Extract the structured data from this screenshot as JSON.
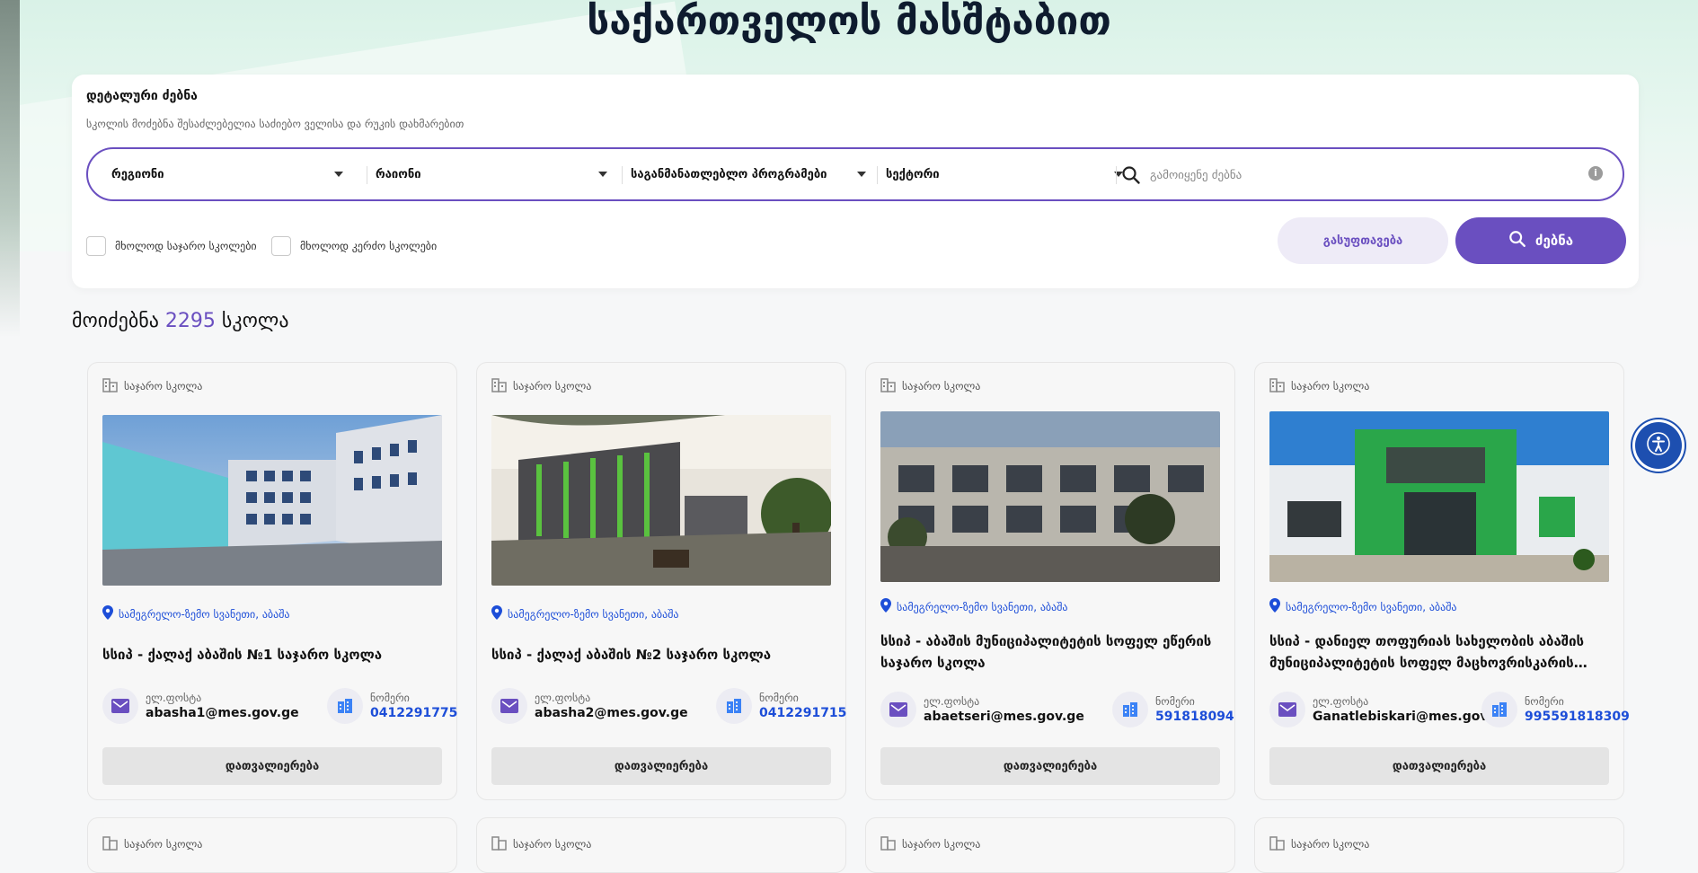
{
  "header": {
    "title": "საქართველოს მასშტაბით"
  },
  "search": {
    "title": "დეტალური ძებნა",
    "subtitle": "სკოლის მოძებნა შესაძლებელია საძიებო ველისა და რუკის დახმარებით",
    "filters": [
      {
        "label": "რეგიონი"
      },
      {
        "label": "რაიონი"
      },
      {
        "label": "საგანმანათლებლო პროგრამები"
      },
      {
        "label": "სექტორი"
      }
    ],
    "placeholder": "გამოიყენე ძებნა",
    "checkbox_public": "მხოლოდ საჯარო სკოლები",
    "checkbox_private": "მხოლოდ კერძო სკოლები",
    "clear_label": "გასუფთავება",
    "search_label": "ძებნა"
  },
  "results": {
    "prefix": "მოიძებნა",
    "count": "2295",
    "suffix": "სკოლა"
  },
  "schools": [
    {
      "type": "საჯარო სკოლა",
      "location": "სამეგრელო-ზემო სვანეთი, აბაშა",
      "name": "სსიპ - ქალაქ აბაშის №1 საჯარო სკოლა",
      "email_label": "ელ.ფოსტა",
      "email": "abasha1@mes.gov.ge",
      "phone_label": "ნომერი",
      "phone": "0412291775",
      "button": "დათვალიერება"
    },
    {
      "type": "საჯარო სკოლა",
      "location": "სამეგრელო-ზემო სვანეთი, აბაშა",
      "name": "სსიპ - ქალაქ აბაშის №2 საჯარო სკოლა",
      "email_label": "ელ.ფოსტა",
      "email": "abasha2@mes.gov.ge",
      "phone_label": "ნომერი",
      "phone": "0412291715",
      "button": "დათვალიერება"
    },
    {
      "type": "საჯარო სკოლა",
      "location": "სამეგრელო-ზემო სვანეთი, აბაშა",
      "name": "სსიპ - აბაშის მუნიციპალიტეტის სოფელ ეწერის საჯარო სკოლა",
      "email_label": "ელ.ფოსტა",
      "email": "abaetseri@mes.gov.ge",
      "phone_label": "ნომერი",
      "phone": "591818094",
      "button": "დათვალიერება"
    },
    {
      "type": "საჯარო სკოლა",
      "location": "სამეგრელო-ზემო სვანეთი, აბაშა",
      "name": "სსიპ - დანიელ თოფურიას სახელობის აბაშის მუნიციპალიტეტის სოფელ მაცხოვრისკარის საჯარო სკოლა",
      "email_label": "ელ.ფოსტა",
      "email": "Ganatlebiskari@mes.gov.ge",
      "phone_label": "ნომერი",
      "phone": "995591818309",
      "button": "დათვალიერება"
    }
  ],
  "next_row": [
    {
      "type": "საჯარო სკოლა"
    },
    {
      "type": "საჯარო სკოლა"
    },
    {
      "type": "საჯარო სკოლა"
    },
    {
      "type": "საჯარო სკოლა"
    }
  ],
  "colors": {
    "accent": "#6a4fc0",
    "link": "#1d4ed8",
    "a11y": "#1d4fb0"
  },
  "icons": {
    "tag": "building-icon",
    "location": "location-pin-icon",
    "email": "mail-icon",
    "phone": "building-icon",
    "search": "search-icon",
    "info": "info-icon",
    "a11y": "accessibility-icon"
  }
}
